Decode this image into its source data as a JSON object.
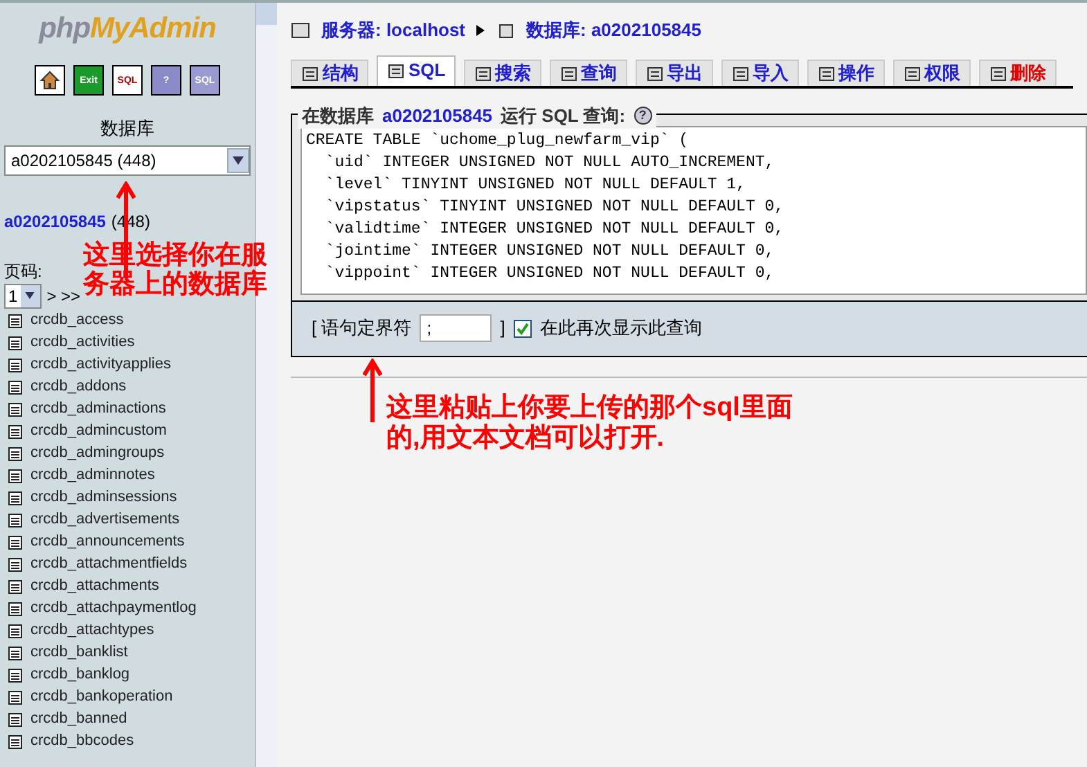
{
  "sidebar": {
    "logo": {
      "php": "php",
      "brand": "MyAdmin"
    },
    "toolbar": [
      {
        "kind": "home"
      },
      {
        "kind": "exit",
        "label": "Exit"
      },
      {
        "kind": "sql",
        "label": "SQL"
      },
      {
        "kind": "help",
        "label": "?"
      },
      {
        "kind": "docs",
        "label": "SQL"
      }
    ],
    "db_label": "数据库",
    "db_select": "a0202105845 (448)",
    "db_link": "a0202105845",
    "db_count": "(448)",
    "page_label": "页码:",
    "page_select": "1",
    "page_next": "> >>",
    "tables": [
      "crcdb_access",
      "crcdb_activities",
      "crcdb_activityapplies",
      "crcdb_addons",
      "crcdb_adminactions",
      "crcdb_admincustom",
      "crcdb_admingroups",
      "crcdb_adminnotes",
      "crcdb_adminsessions",
      "crcdb_advertisements",
      "crcdb_announcements",
      "crcdb_attachmentfields",
      "crcdb_attachments",
      "crcdb_attachpaymentlog",
      "crcdb_attachtypes",
      "crcdb_banklist",
      "crcdb_banklog",
      "crcdb_bankoperation",
      "crcdb_banned",
      "crcdb_bbcodes"
    ]
  },
  "breadcrumb": {
    "server": "服务器: localhost",
    "database": "数据库: a0202105845"
  },
  "tabs": [
    {
      "label": "结构",
      "selected": false,
      "kind": "normal"
    },
    {
      "label": "SQL",
      "selected": true,
      "kind": "normal"
    },
    {
      "label": "搜索",
      "selected": false,
      "kind": "normal"
    },
    {
      "label": "查询",
      "selected": false,
      "kind": "normal"
    },
    {
      "label": "导出",
      "selected": false,
      "kind": "normal"
    },
    {
      "label": "导入",
      "selected": false,
      "kind": "normal"
    },
    {
      "label": "操作",
      "selected": false,
      "kind": "normal"
    },
    {
      "label": "权限",
      "selected": false,
      "kind": "normal"
    },
    {
      "label": "删除",
      "selected": false,
      "kind": "danger"
    }
  ],
  "query_panel": {
    "legend_prefix": "在数据库",
    "legend_db": "a0202105845",
    "legend_suffix": "运行 SQL 查询:",
    "help": "?",
    "sql": "CREATE TABLE `uchome_plug_newfarm_vip` (\n  `uid` INTEGER UNSIGNED NOT NULL AUTO_INCREMENT,\n  `level` TINYINT UNSIGNED NOT NULL DEFAULT 1,\n  `vipstatus` TINYINT UNSIGNED NOT NULL DEFAULT 0,\n  `validtime` INTEGER UNSIGNED NOT NULL DEFAULT 0,\n  `jointime` INTEGER UNSIGNED NOT NULL DEFAULT 0,\n  `vippoint` INTEGER UNSIGNED NOT NULL DEFAULT 0,",
    "delimiter_open": "[ 语句定界符",
    "delimiter": ";",
    "delimiter_close": "]",
    "show_again": {
      "label": "在此再次显示此查询",
      "checked": true
    }
  },
  "annotations": [
    "这里选择你在服务器上的数据库",
    "这里粘贴上你要上传的那个sql里面的,用文本文档可以打开."
  ]
}
